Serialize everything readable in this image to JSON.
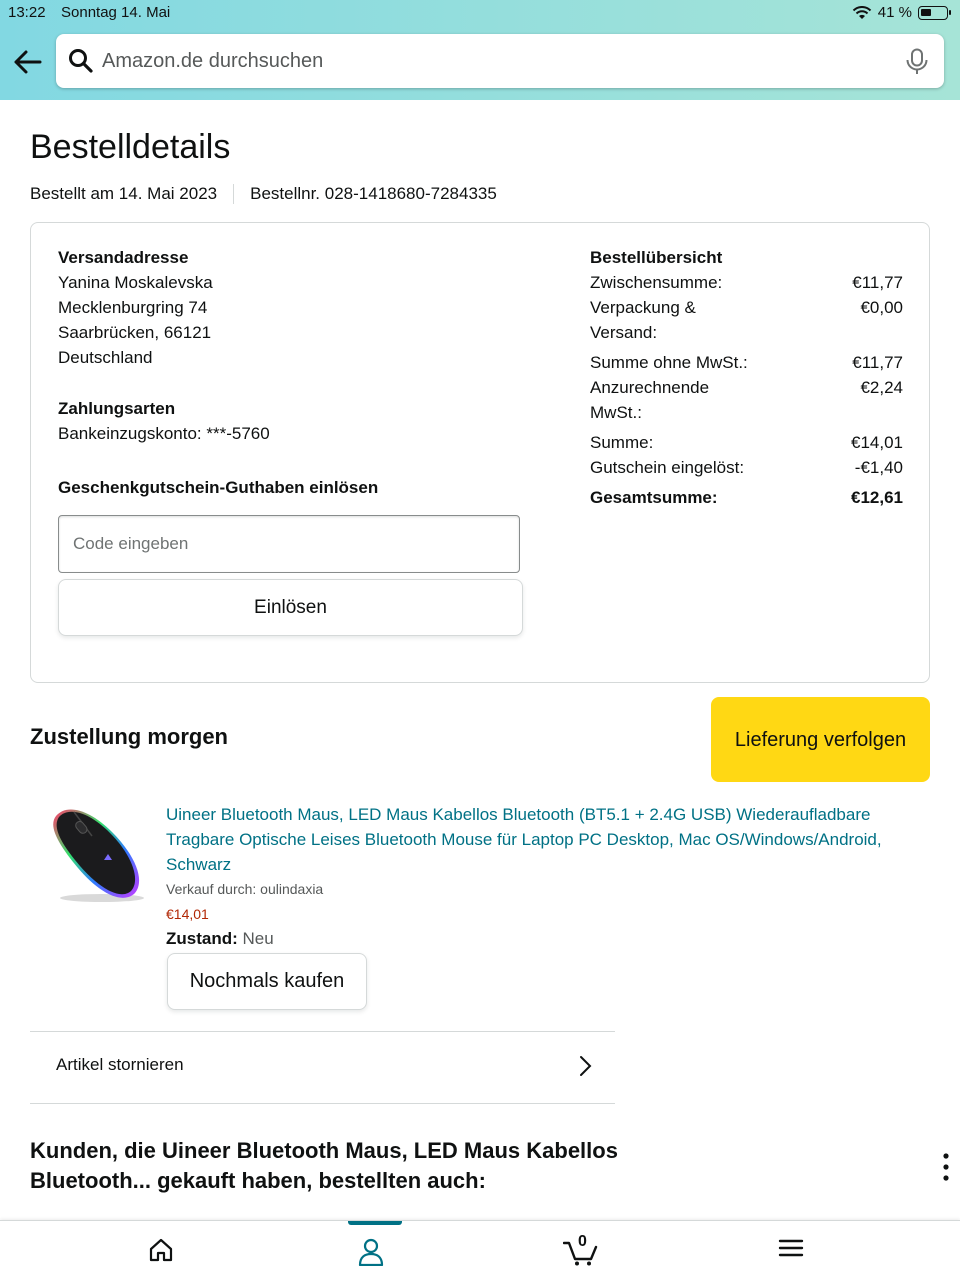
{
  "status_bar": {
    "time": "13:22",
    "date": "Sonntag 14. Mai",
    "battery": "41 %"
  },
  "search": {
    "placeholder": "Amazon.de durchsuchen"
  },
  "page_title": "Bestelldetails",
  "order_meta": {
    "ordered_on": "Bestellt am 14. Mai 2023",
    "order_number": "Bestellnr. 028-1418680-7284335"
  },
  "shipping": {
    "heading": "Versandadresse",
    "lines": [
      "Yanina Moskalevska",
      "Mecklenburgring 74",
      "Saarbrücken, 66121",
      "Deutschland"
    ]
  },
  "payment": {
    "heading": "Zahlungsarten",
    "method": "Bankeinzugskonto: ***-5760"
  },
  "gift_card": {
    "heading": "Geschenkgutschein-Guthaben einlösen",
    "placeholder": "Code eingeben",
    "button": "Einlösen"
  },
  "summary": {
    "heading": "Bestellübersicht",
    "rows": [
      {
        "label": "Zwischensumme:",
        "value": "€11,77"
      },
      {
        "label": "Verpackung & Versand:",
        "value": "€0,00"
      },
      {
        "label": "Summe ohne MwSt.:",
        "value": "€11,77"
      },
      {
        "label": "Anzurechnende MwSt.:",
        "value": "€2,24"
      },
      {
        "label": "Summe:",
        "value": "€14,01"
      },
      {
        "label": "Gutschein eingelöst:",
        "value": "-€1,40"
      },
      {
        "label": "Gesamtsumme:",
        "value": "€12,61"
      }
    ]
  },
  "delivery": {
    "heading": "Zustellung morgen",
    "track_button": "Lieferung verfolgen"
  },
  "product": {
    "title": "Uineer Bluetooth Maus, LED Maus Kabellos Bluetooth (BT5.1 + 2.4G USB) Wiederaufladbare Tragbare Optische Leises Bluetooth Mouse für Laptop PC Desktop, Mac OS/Windows/Android, Schwarz",
    "seller": "Verkauf durch: oulindaxia",
    "price": "€14,01",
    "condition_label": "Zustand:",
    "condition_value": "Neu",
    "buy_again": "Nochmals kaufen"
  },
  "cancel": {
    "label": "Artikel stornieren"
  },
  "also_bought": "Kunden, die Uineer Bluetooth Maus, LED Maus Kabellos Bluetooth... gekauft haben, bestellten auch:",
  "nav": {
    "cart_count": "0",
    "active": "account"
  },
  "colors": {
    "header_gradient_start": "#82d8e2",
    "link": "#007185",
    "price": "#b12704",
    "track_button": "#ffd814"
  }
}
